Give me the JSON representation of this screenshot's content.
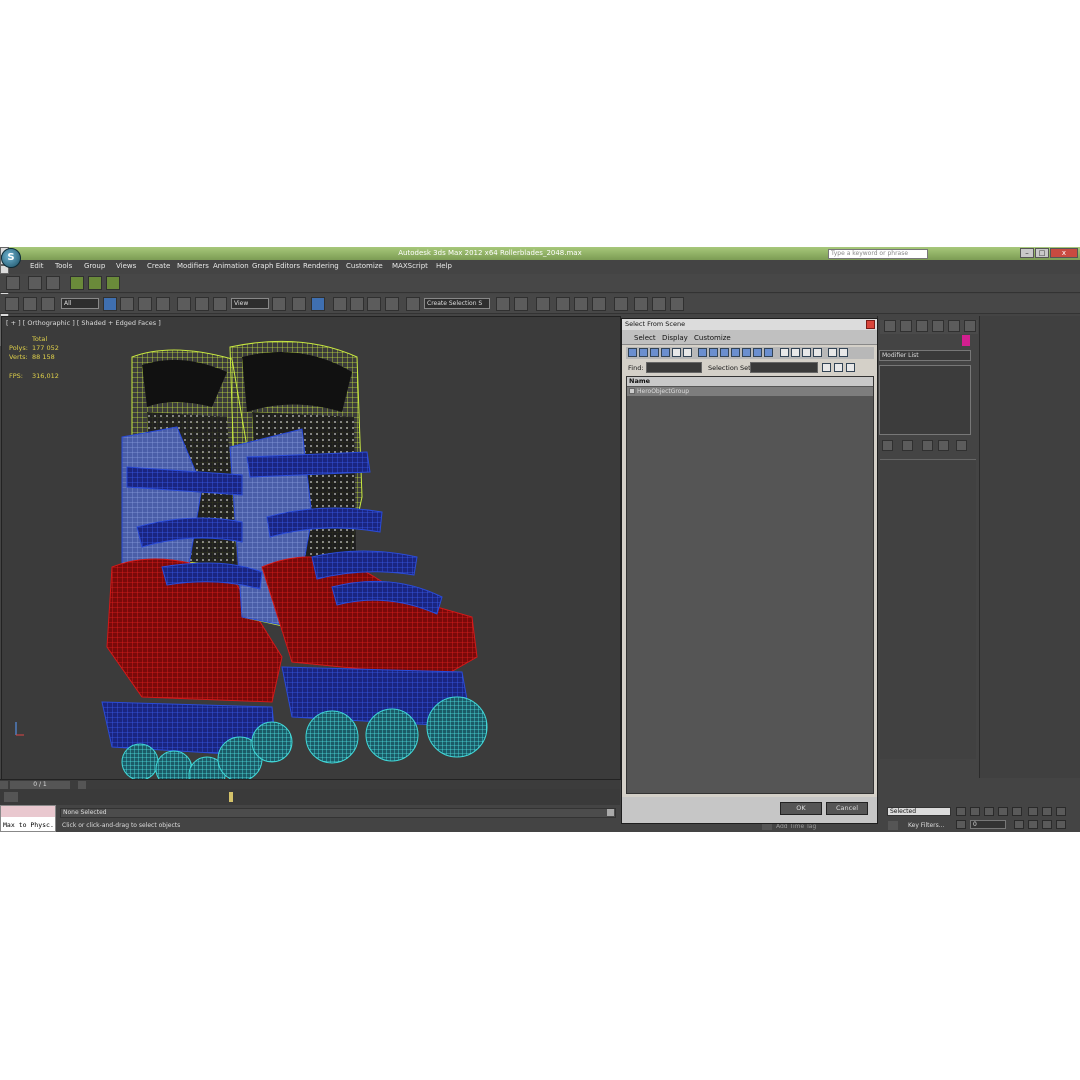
{
  "window": {
    "title": "Autodesk 3ds Max  2012 x64      Rollerblades_2048.max",
    "search_placeholder": "Type a keyword or phrase"
  },
  "menu": [
    "Edit",
    "Tools",
    "Group",
    "Views",
    "Create",
    "Modifiers",
    "Animation",
    "Graph Editors",
    "Rendering",
    "Customize",
    "MAXScript",
    "Help"
  ],
  "toolbar": {
    "selection_filter": "All",
    "ref_coord": "View",
    "named_selection": "Create Selection S"
  },
  "viewport": {
    "label": "[ + ] [ Orthographic ] [ Shaded + Edged Faces ]",
    "stats": {
      "total_label": "Total",
      "polys_label": "Polys:",
      "polys_value": "177 052",
      "verts_label": "Verts:",
      "verts_value": "88 158",
      "fps_label": "FPS:",
      "fps_value": "316,012"
    }
  },
  "timeslider": {
    "frame": "0 / 1"
  },
  "command_panel": {
    "modifier_list": "Modifier List"
  },
  "dialog": {
    "title": "Select From Scene",
    "menu": [
      "Select",
      "Display",
      "Customize"
    ],
    "find_label": "Find:",
    "selection_set_label": "Selection Set:",
    "column_name": "Name",
    "rows": [
      "HeroObjectGroup"
    ],
    "ok_label": "OK",
    "cancel_label": "Cancel"
  },
  "status": {
    "maxscript_text": "Max to Physc.",
    "selection": "None Selected",
    "prompt": "Click or click-and-drag to select objects",
    "add_time_tag": "Add Time Tag",
    "selected_dropdown": "Selected",
    "key_filters": "Key Filters...",
    "current_frame": "0"
  },
  "colors": {
    "title_green": "#8db060",
    "viewport_bg": "#3b3b3b",
    "ui_bg": "#444444",
    "wire_yellow": "#c8e840",
    "wire_red": "#d41818",
    "wire_blue": "#2a4bd8",
    "wire_cyan": "#40d8d8",
    "stat_yellow": "#e0d14a"
  }
}
